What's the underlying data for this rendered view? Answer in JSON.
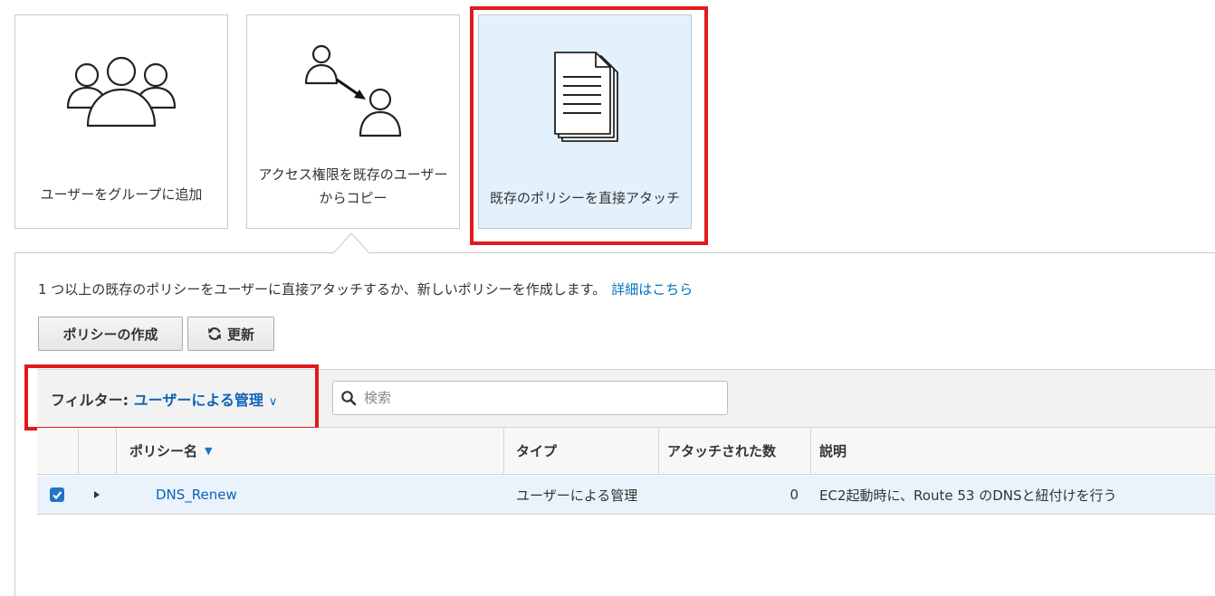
{
  "options": [
    {
      "label": "ユーザーをグループに追加",
      "icon": "user-group-icon",
      "selected": false
    },
    {
      "label": "アクセス権限を既存のユーザーからコピー",
      "icon": "copy-permissions-icon",
      "selected": false
    },
    {
      "label": "既存のポリシーを直接アタッチ",
      "icon": "document-icon",
      "selected": true
    }
  ],
  "description": {
    "text": "1 つ以上の既存のポリシーをユーザーに直接アタッチするか、新しいポリシーを作成します。",
    "link": "詳細はこちら"
  },
  "toolbar": {
    "create_label": "ポリシーの作成",
    "refresh_label": "更新"
  },
  "filter": {
    "label": "フィルター:",
    "value": "ユーザーによる管理",
    "icon": "chevron-down-icon"
  },
  "search": {
    "placeholder": "検索",
    "value": "",
    "icon": "search-icon"
  },
  "table": {
    "columns": [
      "ポリシー名",
      "タイプ",
      "アタッチされた数",
      "説明"
    ],
    "sort_column": "ポリシー名",
    "rows": [
      {
        "checked": true,
        "name": "DNS_Renew",
        "type": "ユーザーによる管理",
        "attached": "0",
        "description": "EC2起動時に、Route 53 のDNSと紐付けを行う"
      }
    ]
  },
  "colors": {
    "highlight": "#e3191b",
    "link": "#0d63b6",
    "selected_card": "#e3f1fd",
    "selected_row": "#eaf3fb"
  }
}
